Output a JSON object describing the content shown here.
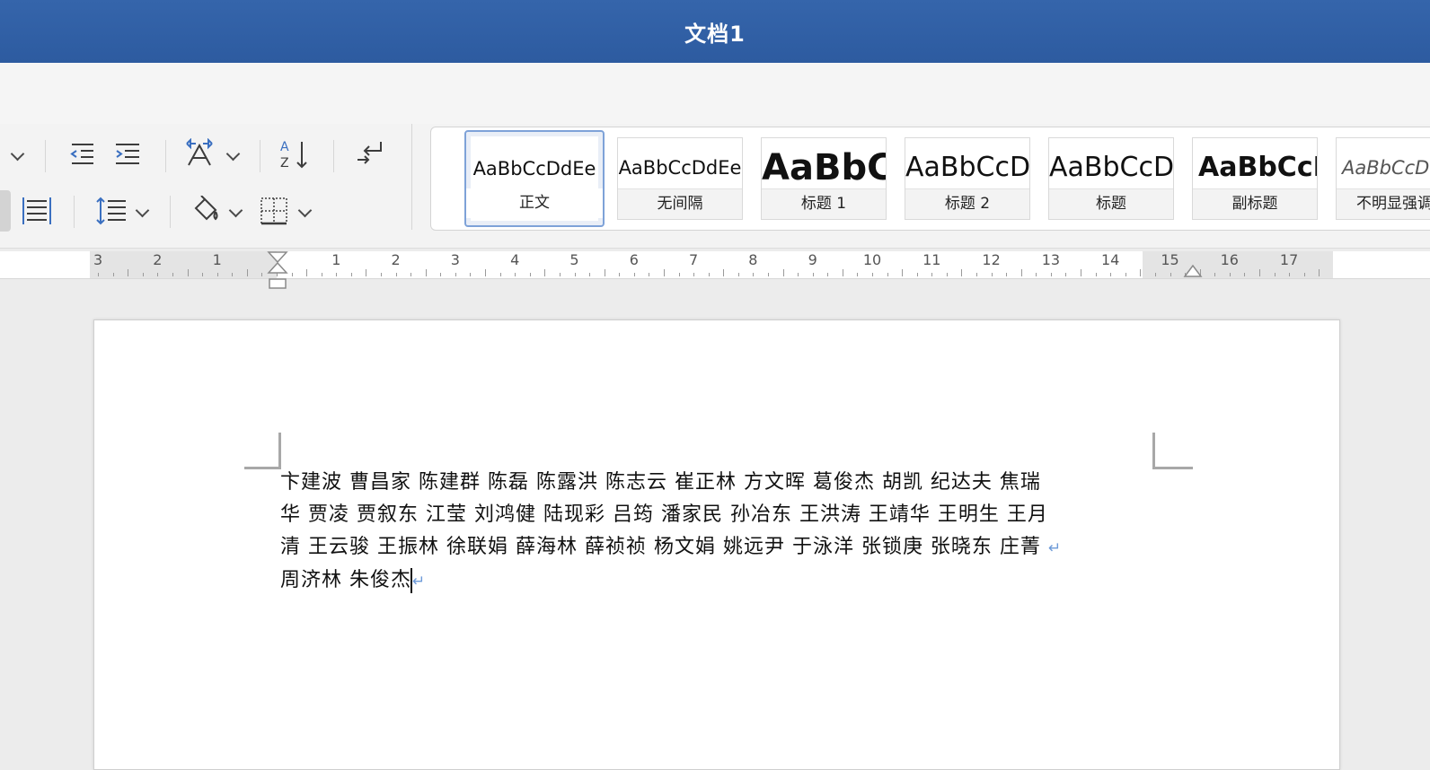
{
  "window": {
    "title": "文档1"
  },
  "styles": [
    {
      "sample": "AaBbCcDdEe",
      "name": "正文",
      "selected": true
    },
    {
      "sample": "AaBbCcDdEe",
      "name": "无间隔"
    },
    {
      "sample": "AaBbC",
      "name": "标题 1"
    },
    {
      "sample": "AaBbCcD",
      "name": "标题 2"
    },
    {
      "sample": "AaBbCcD",
      "name": "标题"
    },
    {
      "sample": "AaBbCcD",
      "name": "副标题"
    },
    {
      "sample": "AaBbCcDd",
      "name": "不明显强调"
    }
  ],
  "ruler": {
    "numbers": [
      "3",
      "2",
      "1",
      "1",
      "2",
      "3",
      "4",
      "5",
      "6",
      "7",
      "8",
      "9",
      "10",
      "11",
      "12",
      "13",
      "14",
      "15",
      "16",
      "17"
    ]
  },
  "document": {
    "lines": [
      "卞建波 曹昌家 陈建群 陈磊 陈露洪 陈志云 崔正林 方文晖 葛俊杰 胡凯 纪达夫 焦瑞",
      "华 贾凌 贾叙东 江莹 刘鸿健 陆现彩 吕筠 潘家民 孙冶东 王洪涛 王靖华 王明生 王月",
      "清 王云骏 王振林 徐联娟 薛海林 薛祯祯 杨文娟 姚远尹 于泳洋 张锁庚 张晓东 庄菁",
      "周济林 朱俊杰"
    ],
    "paragraph_mark": "↵"
  }
}
